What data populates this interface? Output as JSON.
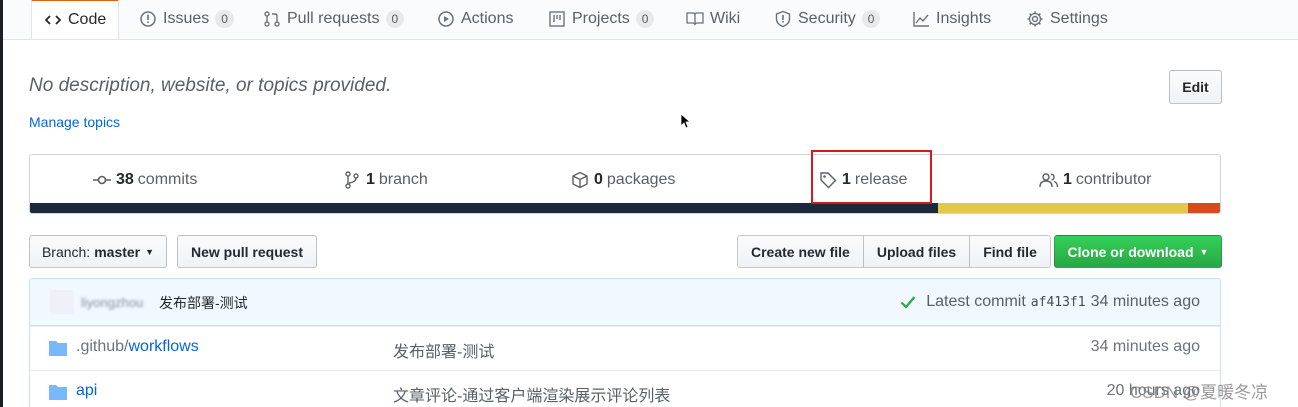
{
  "tabs": [
    {
      "label": "Code",
      "icon": "code-icon",
      "active": true
    },
    {
      "label": "Issues",
      "icon": "issue-icon",
      "count": "0"
    },
    {
      "label": "Pull requests",
      "icon": "pull-request-icon",
      "count": "0"
    },
    {
      "label": "Actions",
      "icon": "play-icon"
    },
    {
      "label": "Projects",
      "icon": "project-icon",
      "count": "0"
    },
    {
      "label": "Wiki",
      "icon": "book-icon"
    },
    {
      "label": "Security",
      "icon": "shield-icon",
      "count": "0"
    },
    {
      "label": "Insights",
      "icon": "graph-icon"
    },
    {
      "label": "Settings",
      "icon": "gear-icon"
    }
  ],
  "repo": {
    "description": "No description, website, or topics provided.",
    "manage_topics": "Manage topics",
    "edit": "Edit"
  },
  "summary": {
    "commits": {
      "num": "38",
      "label": "commits"
    },
    "branches": {
      "num": "1",
      "label": "branch"
    },
    "packages": {
      "num": "0",
      "label": "packages"
    },
    "releases": {
      "num": "1",
      "label": "release"
    },
    "contributors": {
      "num": "1",
      "label": "contributor"
    }
  },
  "languages": [
    {
      "color": "#1b2a3a",
      "share": 0.763
    },
    {
      "color": "#e3c74c",
      "share": 0.21
    },
    {
      "color": "#d84a1b",
      "share": 0.027
    }
  ],
  "toolbar": {
    "branch_prefix": "Branch:",
    "branch": "master",
    "new_pr": "New pull request",
    "create_file": "Create new file",
    "upload_files": "Upload files",
    "find_file": "Find file",
    "clone": "Clone or download"
  },
  "commit": {
    "author": "liyongzhou",
    "message": "发布部署-测试",
    "latest_label": "Latest commit",
    "sha": "af413f1",
    "time": "34 minutes ago"
  },
  "files": [
    {
      "dir": ".github/",
      "name": "workflows",
      "message": "发布部署-测试",
      "age": "34 minutes ago"
    },
    {
      "dir": "",
      "name": "api",
      "message": "文章评论-通过客户端渲染展示评论列表",
      "age": "20 hours ago"
    }
  ],
  "watermark": "CSDN @夏暖冬凉",
  "colors": {
    "accent": "#e36209",
    "link": "#0366d6",
    "green": "#28a745",
    "highlight": "#d7191c"
  }
}
